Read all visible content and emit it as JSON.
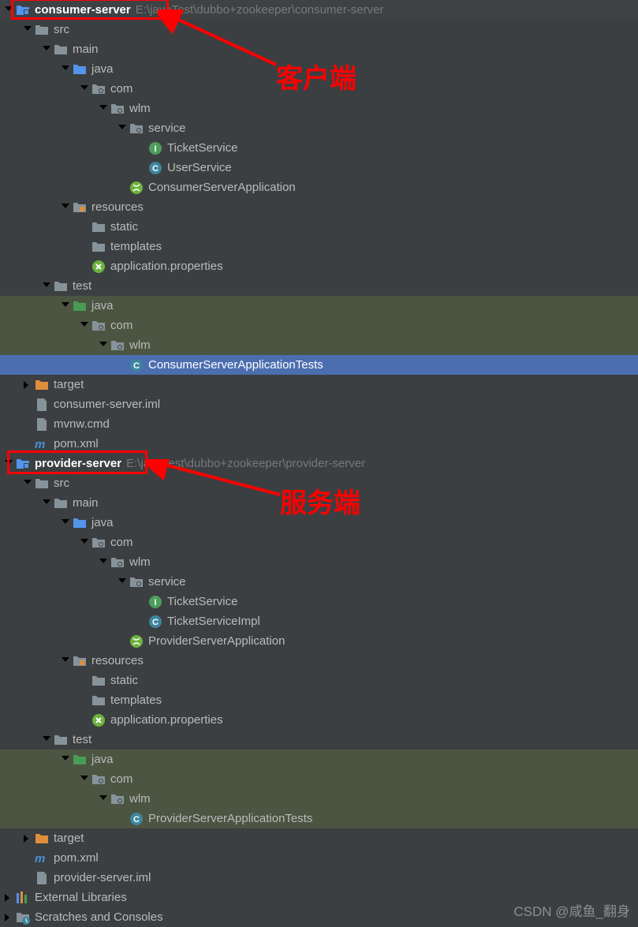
{
  "tree": {
    "consumer_server": {
      "name": "consumer-server",
      "path": "E:\\javaTest\\dubbo+zookeeper\\consumer-server",
      "src": "src",
      "main": "main",
      "java": "java",
      "com": "com",
      "wlm": "wlm",
      "service": "service",
      "ticket_service": "TicketService",
      "user_service": "UserService",
      "app": "ConsumerServerApplication",
      "resources": "resources",
      "static": "static",
      "templates": "templates",
      "properties": "application.properties",
      "test": "test",
      "test_java": "java",
      "test_com": "com",
      "test_wlm": "wlm",
      "test_app": "ConsumerServerApplicationTests",
      "target": "target",
      "iml": "consumer-server.iml",
      "mvnw": "mvnw.cmd",
      "pom": "pom.xml"
    },
    "provider_server": {
      "name": "provider-server",
      "path": "E:\\javaTest\\dubbo+zookeeper\\provider-server",
      "src": "src",
      "main": "main",
      "java": "java",
      "com": "com",
      "wlm": "wlm",
      "service": "service",
      "ticket_service": "TicketService",
      "ticket_impl": "TicketServiceImpl",
      "app": "ProviderServerApplication",
      "resources": "resources",
      "static": "static",
      "templates": "templates",
      "properties": "application.properties",
      "test": "test",
      "test_java": "java",
      "test_com": "com",
      "test_wlm": "wlm",
      "test_app": "ProviderServerApplicationTests",
      "target": "target",
      "pom": "pom.xml",
      "iml": "provider-server.iml"
    },
    "ext_libs": "External Libraries",
    "scratches": "Scratches and Consoles"
  },
  "annotations": {
    "client": "客户端",
    "server": "服务端"
  },
  "watermark": "CSDN @咸鱼_翻身"
}
